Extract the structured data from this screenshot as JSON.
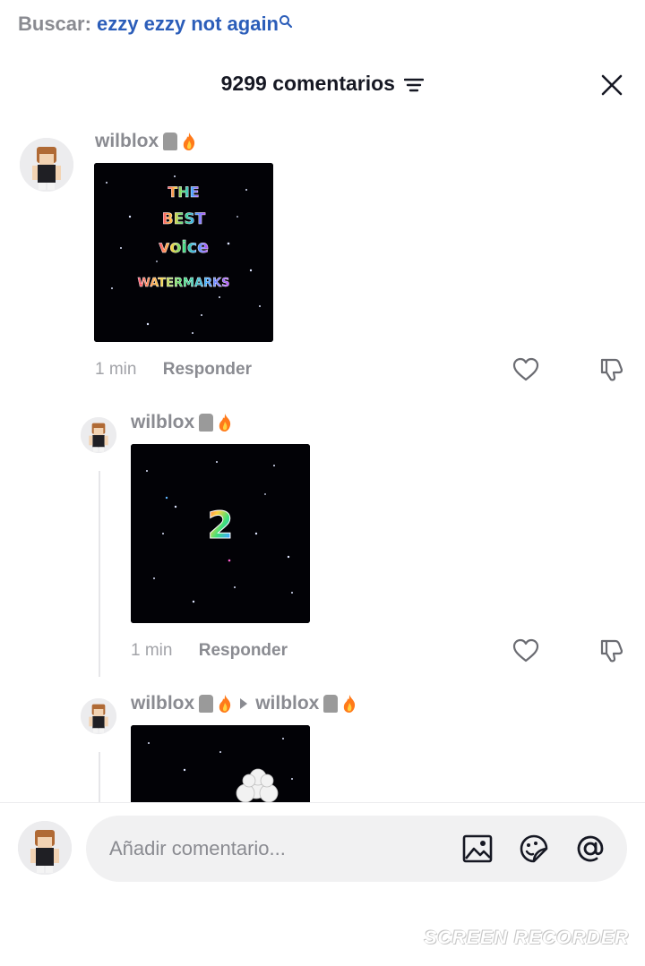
{
  "search": {
    "label": "Buscar:",
    "query": "ezzy ezzy not again"
  },
  "header": {
    "title": "9299 comentarios"
  },
  "comments": [
    {
      "username": "wilblox",
      "time": "1 min",
      "reply": "Responder",
      "media_text": [
        "THE",
        "BEST",
        "voice",
        "WATERMARKS"
      ]
    },
    {
      "username": "wilblox",
      "time": "1 min",
      "reply": "Responder",
      "media_text": [
        "2"
      ]
    },
    {
      "username": "wilblox",
      "reply_to": "wilblox"
    }
  ],
  "composer": {
    "placeholder": "Añadir comentario..."
  },
  "watermark": "SCREEN RECORDER",
  "colors": {
    "link": "#2b5db9",
    "muted": "#8a8b91",
    "bg_input": "#f1f1f2"
  }
}
